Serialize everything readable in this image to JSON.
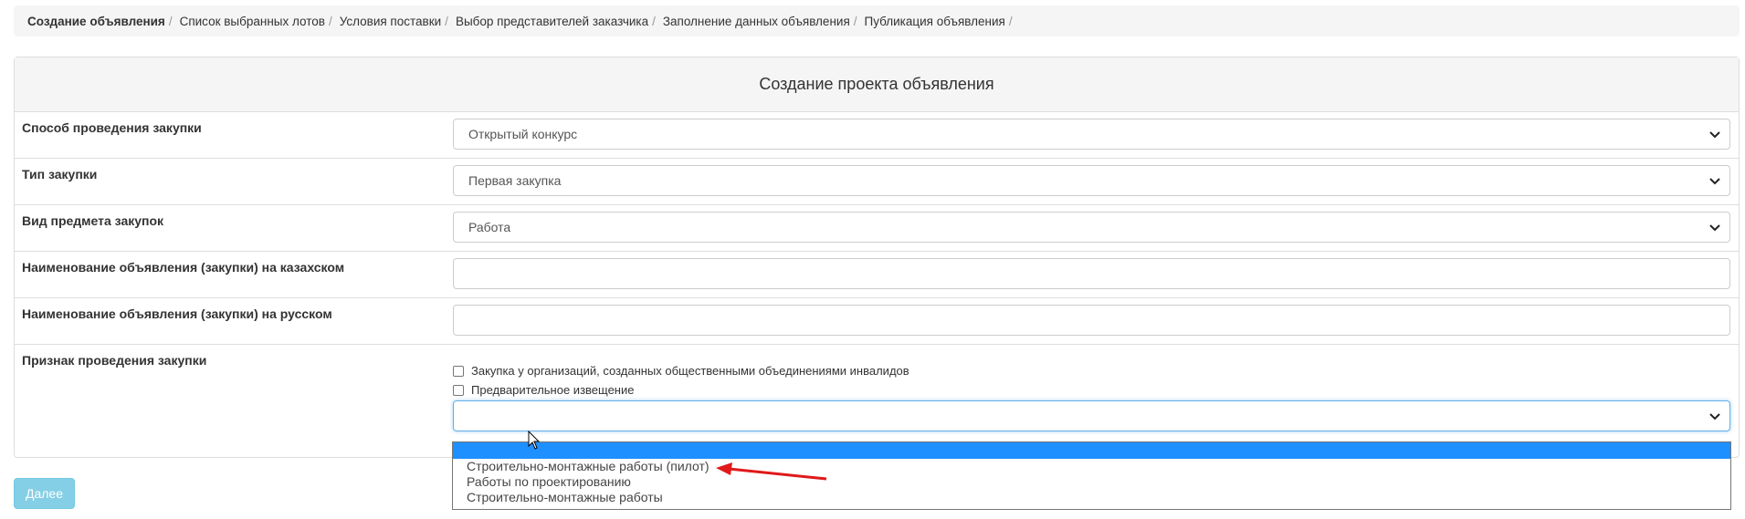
{
  "breadcrumb": {
    "items": [
      "Создание объявления",
      "Список выбранных лотов",
      "Условия поставки",
      "Выбор представителей заказчика",
      "Заполнение данных объявления",
      "Публикация объявления"
    ],
    "separator": "/"
  },
  "panel": {
    "title": "Создание проекта объявления",
    "fields": [
      {
        "label": "Способ проведения закупки",
        "value": "Открытый конкурс"
      },
      {
        "label": "Тип закупки",
        "value": "Первая закупка"
      },
      {
        "label": "Вид предмета закупок",
        "value": "Работа"
      },
      {
        "label": "Наименование объявления (закупки) на казахском",
        "value": ""
      },
      {
        "label": "Наименование объявления (закупки) на русском",
        "value": ""
      }
    ],
    "sign": {
      "label": "Признак проведения закупки",
      "checkbox1": "Закупка у организаций, созданных общественными объединениями инвалидов",
      "checkbox2": "Предварительное извещение",
      "select_value": ""
    }
  },
  "dropdown": {
    "options": [
      "",
      "Строительно-монтажные работы (пилот)",
      "Работы по проектированию",
      "Строительно-монтажные работы"
    ],
    "highlighted_index": 0
  },
  "buttons": {
    "next": "Далее"
  },
  "colors": {
    "accent": "#5bc0de",
    "highlight": "#1e90ff",
    "annotation_arrow": "#e0191b"
  }
}
